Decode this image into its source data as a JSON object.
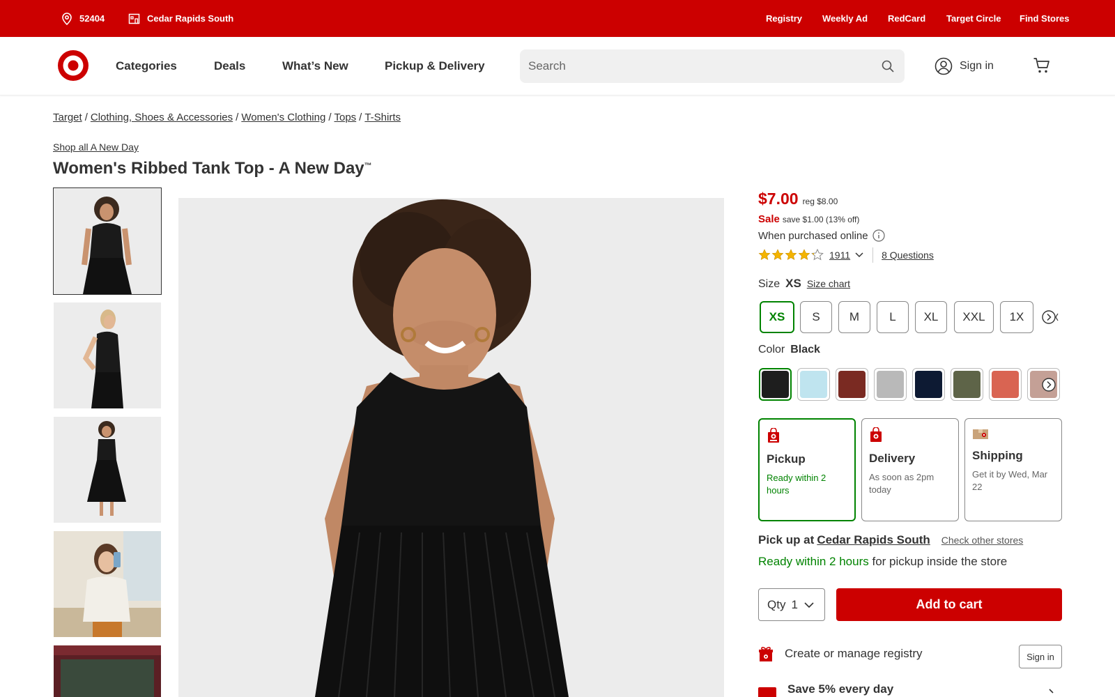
{
  "utility": {
    "zip": "52404",
    "store": "Cedar Rapids South",
    "links": [
      "Registry",
      "Weekly Ad",
      "RedCard",
      "Target Circle",
      "Find Stores"
    ]
  },
  "nav": {
    "items": [
      "Categories",
      "Deals",
      "What’s New",
      "Pickup & Delivery"
    ],
    "search_placeholder": "Search",
    "signin": "Sign in"
  },
  "breadcrumb": [
    "Target",
    "Clothing, Shoes & Accessories",
    "Women's Clothing",
    "Tops",
    "T-Shirts"
  ],
  "product": {
    "shop_all": "Shop all A New Day",
    "title": "Women's Ribbed Tank Top - A New Day",
    "trademark": "™",
    "price": "$7.00",
    "reg_price": "reg $8.00",
    "sale_label": "Sale",
    "save_text": "save $1.00 (13% off)",
    "purchased_online": "When purchased online",
    "rating": 4.3,
    "rating_count": "1911",
    "questions": "8 Questions"
  },
  "size": {
    "label": "Size",
    "selected": "XS",
    "chart_link": "Size chart",
    "options": [
      "XS",
      "S",
      "M",
      "L",
      "XL",
      "XXL",
      "1X"
    ]
  },
  "color": {
    "label": "Color",
    "selected": "Black",
    "swatches": [
      "#1e1e1e",
      "#bfe4ef",
      "#7a2a22",
      "#b9b9b9",
      "#0d1a33",
      "#5e6448",
      "#d96452",
      "#c4a096"
    ]
  },
  "fulfillment": [
    {
      "title": "Pickup",
      "sub": "Ready within 2 hours"
    },
    {
      "title": "Delivery",
      "sub": "As soon as 2pm today"
    },
    {
      "title": "Shipping",
      "sub": "Get it by Wed, Mar 22"
    }
  ],
  "pickup": {
    "prefix": "Pick up at",
    "store": "Cedar Rapids South",
    "other": "Check other stores",
    "ready_green": "Ready within 2 hours",
    "ready_rest": "for pickup inside the store"
  },
  "cart": {
    "qty_label": "Qty",
    "qty_value": "1",
    "add_label": "Add to cart"
  },
  "registry": {
    "text": "Create or manage registry",
    "signin": "Sign in"
  },
  "save5": {
    "text": "Save 5% every day"
  },
  "colors": {
    "brand_red": "#cc0000",
    "success_green": "#008300"
  }
}
